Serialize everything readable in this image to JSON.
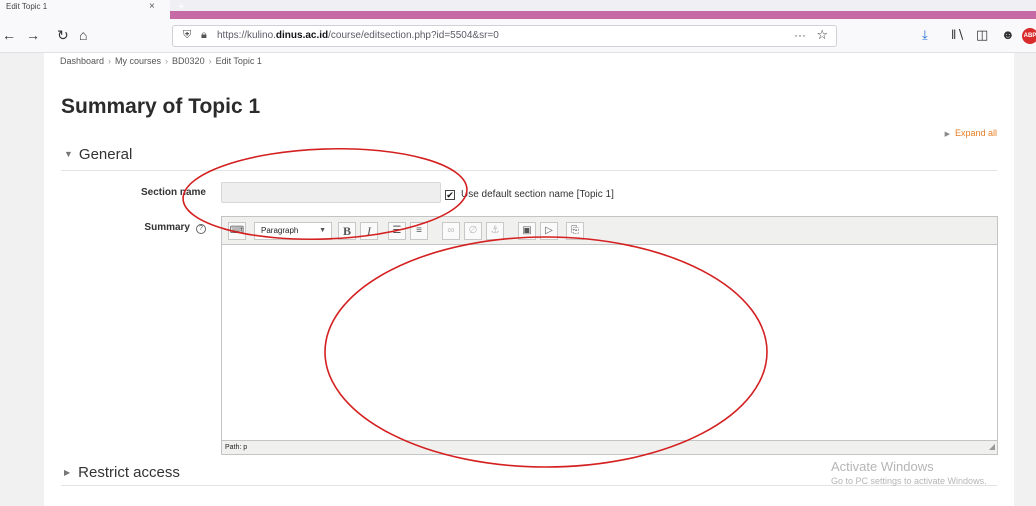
{
  "browser": {
    "tab_title": "Edit Topic 1",
    "tab_close": "×",
    "new_tab": "+",
    "url_prefix": "https://kulino.",
    "url_domain": "dinus.ac.id",
    "url_path": "/course/editsection.php?id=5504&sr=0",
    "url_more": "···",
    "icons": {
      "back": "back-icon",
      "forward": "forward-icon",
      "reload": "reload-icon",
      "home": "home-icon",
      "shield": "shield-icon",
      "lock": "lock-icon",
      "bookmark": "star-icon",
      "download": "download-icon",
      "library": "library-icon",
      "sidebar": "sidebar-icon",
      "account": "account-icon",
      "adblock": "adblock-icon"
    },
    "accent_color": "#c66aa6"
  },
  "breadcrumb": [
    "Dashboard",
    "My courses",
    "BD0320",
    "Edit Topic 1"
  ],
  "page_title": "Summary of Topic 1",
  "expand_all": "Expand all",
  "general": {
    "legend": "General",
    "section_name_label": "Section name",
    "section_name_value": "",
    "use_default_label": "Use default section name [Topic 1]",
    "use_default_checked": true,
    "summary_label": "Summary"
  },
  "editor": {
    "paragraph_select": "Paragraph",
    "status_path": "Path: p",
    "toolbar_icons": [
      "toolbar-toggle-icon",
      "bold-icon",
      "italic-icon",
      "unordered-list-icon",
      "ordered-list-icon",
      "link-icon",
      "unlink-icon",
      "anchor-icon",
      "image-icon",
      "media-icon",
      "paste-icon"
    ]
  },
  "restrict_access": "Restrict access",
  "watermark": {
    "title": "Activate Windows",
    "subtitle": "Go to PC settings to activate Windows."
  },
  "annotation_color": "#d42020"
}
